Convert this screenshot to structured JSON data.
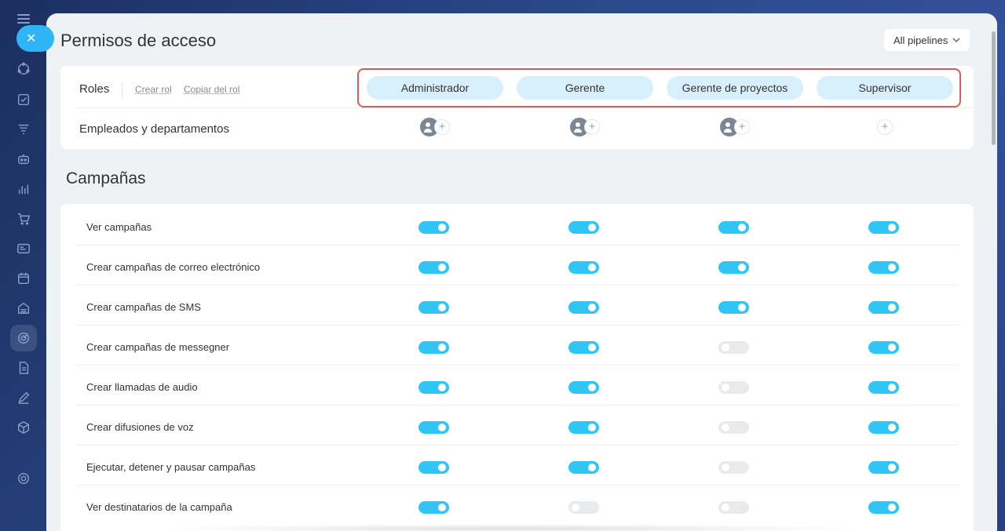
{
  "page": {
    "title": "Permisos de acceso",
    "pipeline_select": "All pipelines"
  },
  "roles": {
    "label": "Roles",
    "create_link": "Crear rol",
    "copy_link": "Copiar del rol",
    "employees_label": "Empleados y departamentos",
    "items": [
      {
        "label": "Administrador",
        "has_assignees": true
      },
      {
        "label": "Gerente",
        "has_assignees": true
      },
      {
        "label": "Gerente de proyectos",
        "has_assignees": true
      },
      {
        "label": "Supervisor",
        "has_assignees": false
      }
    ],
    "highlight_color": "#e05a5a"
  },
  "section": {
    "title": "Campañas"
  },
  "permissions": [
    {
      "label": "Ver campañas",
      "values": [
        true,
        true,
        true,
        true
      ]
    },
    {
      "label": "Crear campañas de correo electrónico",
      "values": [
        true,
        true,
        true,
        true
      ]
    },
    {
      "label": "Crear campañas de SMS",
      "values": [
        true,
        true,
        true,
        true
      ]
    },
    {
      "label": "Crear campañas de messegner",
      "values": [
        true,
        true,
        false,
        true
      ]
    },
    {
      "label": "Crear llamadas de audio",
      "values": [
        true,
        true,
        false,
        true
      ]
    },
    {
      "label": "Crear difusiones de voz",
      "values": [
        true,
        true,
        false,
        true
      ]
    },
    {
      "label": "Ejecutar, detener y pausar campañas",
      "values": [
        true,
        true,
        false,
        true
      ]
    },
    {
      "label": "Ver destinatarios de la campaña",
      "values": [
        true,
        false,
        false,
        true
      ]
    }
  ],
  "colors": {
    "toggle_on": "#2fc6f6",
    "toggle_off": "#e8eaec",
    "role_pill": "#d8f0fb",
    "close_button": "#2fb4f6"
  },
  "sidebar": {
    "icons": [
      "menu-icon",
      "close-icon",
      "contacts-icon",
      "tasks-icon",
      "funnel-icon",
      "robot-icon",
      "analytics-icon",
      "cart-icon",
      "contact-card-icon",
      "calendar-icon",
      "inventory-icon",
      "marketing-icon",
      "documents-icon",
      "edit-icon",
      "box-icon",
      "settings-icon"
    ]
  }
}
